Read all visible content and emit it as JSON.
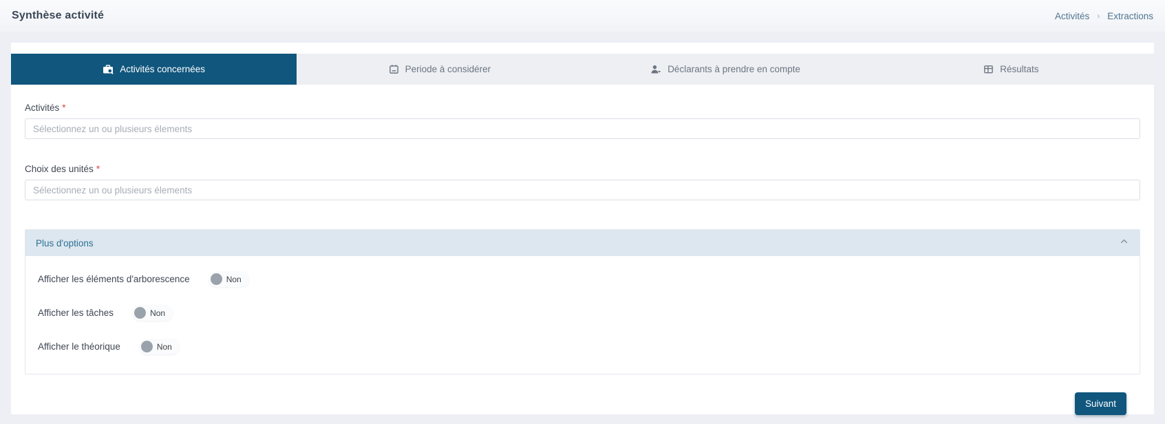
{
  "header": {
    "title": "Synthèse activité",
    "breadcrumb": {
      "items": [
        {
          "label": "Activités"
        },
        {
          "label": "Extractions"
        }
      ],
      "separator": "›"
    }
  },
  "tabs": [
    {
      "label": "Activités concernées",
      "icon": "briefcase-search-icon",
      "active": true
    },
    {
      "label": "Periode à considérer",
      "icon": "calendar-icon",
      "active": false
    },
    {
      "label": "Déclarants à prendre en compte",
      "icon": "user-icon",
      "active": false
    },
    {
      "label": "Résultats",
      "icon": "table-icon",
      "active": false
    }
  ],
  "form": {
    "fields": [
      {
        "label": "Activités",
        "required_marker": "*",
        "placeholder": "Sélectionnez un ou plusieurs élements",
        "value": ""
      },
      {
        "label": "Choix des unités",
        "required_marker": "*",
        "placeholder": "Sélectionnez un ou plusieurs élements",
        "value": ""
      }
    ],
    "options_panel": {
      "title": "Plus d'options",
      "collapse_icon": "chevron-up-icon",
      "rows": [
        {
          "label": "Afficher les éléments d'arborescence",
          "toggle_value": "Non"
        },
        {
          "label": "Afficher les tâches",
          "toggle_value": "Non"
        },
        {
          "label": "Afficher le théorique",
          "toggle_value": "Non"
        }
      ]
    },
    "next_button_label": "Suivant"
  },
  "colors": {
    "accent_blue": "#10567d",
    "panel_header_bg": "#dde7ef",
    "panel_title_text": "#2d7096",
    "breadcrumb_link": "#517590",
    "required_marker": "#d64541",
    "inactive_tab_bg": "#edeff3",
    "page_bg": "#edeff4",
    "toggle_knob": "#9aa2ab"
  }
}
